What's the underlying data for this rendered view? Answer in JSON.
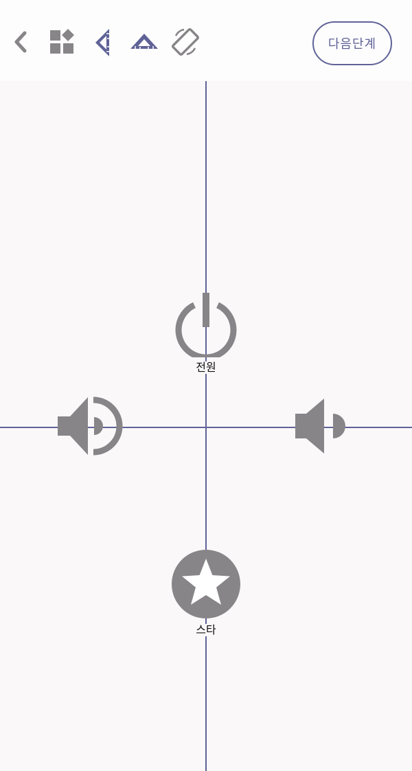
{
  "toolbar": {
    "back_icon": "chevron-left-icon",
    "widgets_icon": "widgets-icon",
    "ruler_vertical_icon": "triangle-ruler-vertical-icon",
    "ruler_horizontal_icon": "triangle-ruler-horizontal-icon",
    "rotate_icon": "screen-rotation-icon",
    "next_label": "다음단계"
  },
  "keys": {
    "power": {
      "label": "전원",
      "icon": "power-icon"
    },
    "volume_up": {
      "icon": "volume-up-icon"
    },
    "volume_down": {
      "icon": "volume-down-icon"
    },
    "star": {
      "label": "스타",
      "icon": "star-icon"
    }
  },
  "colors": {
    "accent": "#5f6297",
    "icon_gray": "#878588",
    "background": "#faf8f9",
    "toolbar_bg": "#fefdfd"
  }
}
